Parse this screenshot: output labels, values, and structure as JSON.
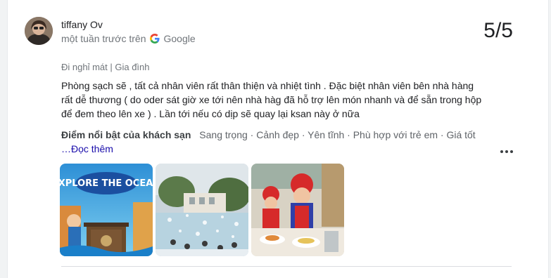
{
  "review": {
    "author": "tiffany Ov",
    "time_ago": "một tuần trước trên",
    "source": "Google",
    "score": "5/5",
    "trip_type": "Đi nghỉ mát | Gia đình",
    "text_lines": [
      "Phòng sạch sẽ , tất cả nhân viên rất thân thiện và nhiệt tình . Đặc biệt nhân viên bên nhà hàng",
      "rất dễ thương ( do oder sát giờ xe tới nên nhà hàg đã hỗ trợ lên món nhanh và để sẵn trong hộp",
      "để đem theo lên xe ) . Lần tới nếu có dịp sẽ quay lại ksan này ở nữa"
    ],
    "highlights_title": "Điểm nổi bật của khách sạn",
    "highlights_values": "Sang trọng · Cảnh đẹp · Yên tĩnh · Phù hợp với trẻ em · Giá tốt",
    "read_more": "…Đọc thêm",
    "photo_1_text": "EXPLORE THE OCEAN"
  },
  "icons": {
    "source_logo": "google-g-icon",
    "more": "more-options-icon"
  },
  "colors": {
    "link": "#1a0dab",
    "muted": "#70757a"
  }
}
